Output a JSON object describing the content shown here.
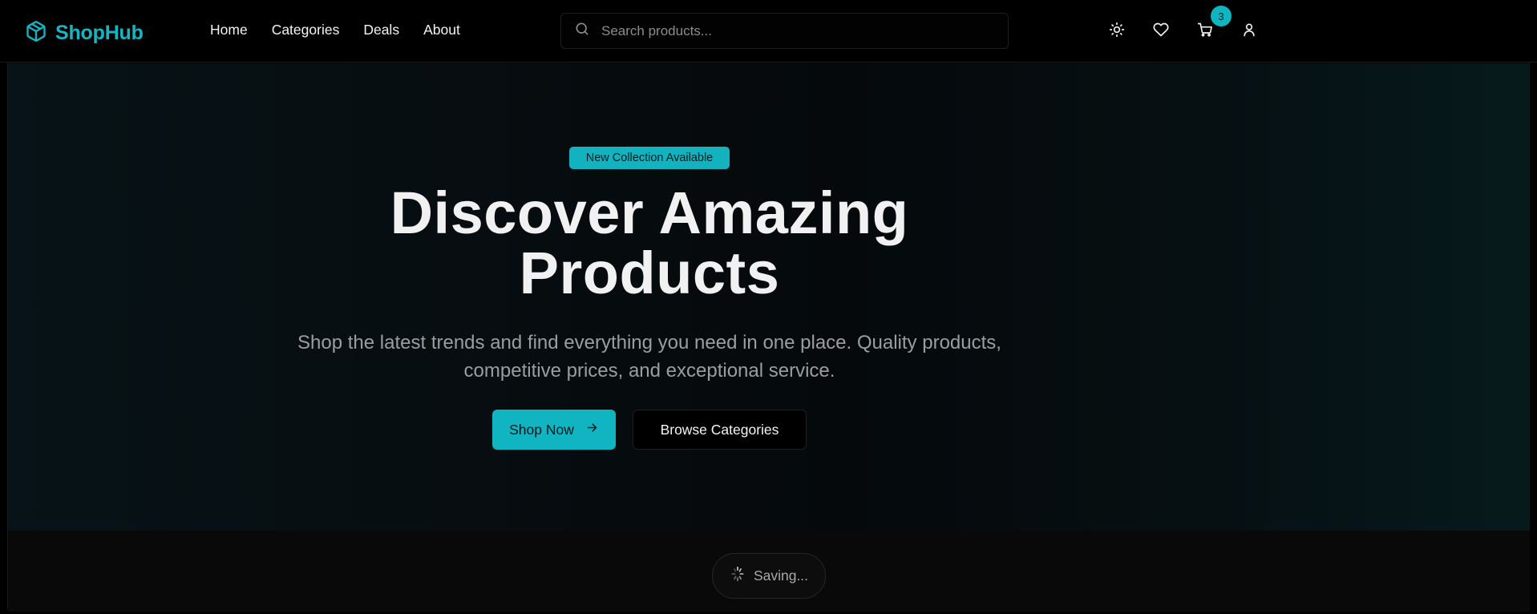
{
  "brand": {
    "name": "ShopHub",
    "icon": "package-icon",
    "color": "#13b6c2"
  },
  "nav": {
    "items": [
      "Home",
      "Categories",
      "Deals",
      "About"
    ]
  },
  "search": {
    "placeholder": "Search products...",
    "value": ""
  },
  "header_icons": {
    "theme": "sun-icon",
    "wishlist": "heart-icon",
    "cart": "cart-icon",
    "account": "user-icon",
    "cart_count": "3"
  },
  "hero": {
    "badge": "New Collection Available",
    "title_line1": "Discover Amazing",
    "title_line2": "Products",
    "subtitle_line1": "Shop the latest trends and find everything you need in one place. Quality products,",
    "subtitle_line2": "competitive prices, and exceptional service.",
    "primary_button": "Shop Now",
    "secondary_button": "Browse Categories"
  },
  "status": {
    "label": "Saving..."
  },
  "colors": {
    "accent": "#11b5c1",
    "background": "#000000",
    "muted_text": "#9a9ea0"
  }
}
